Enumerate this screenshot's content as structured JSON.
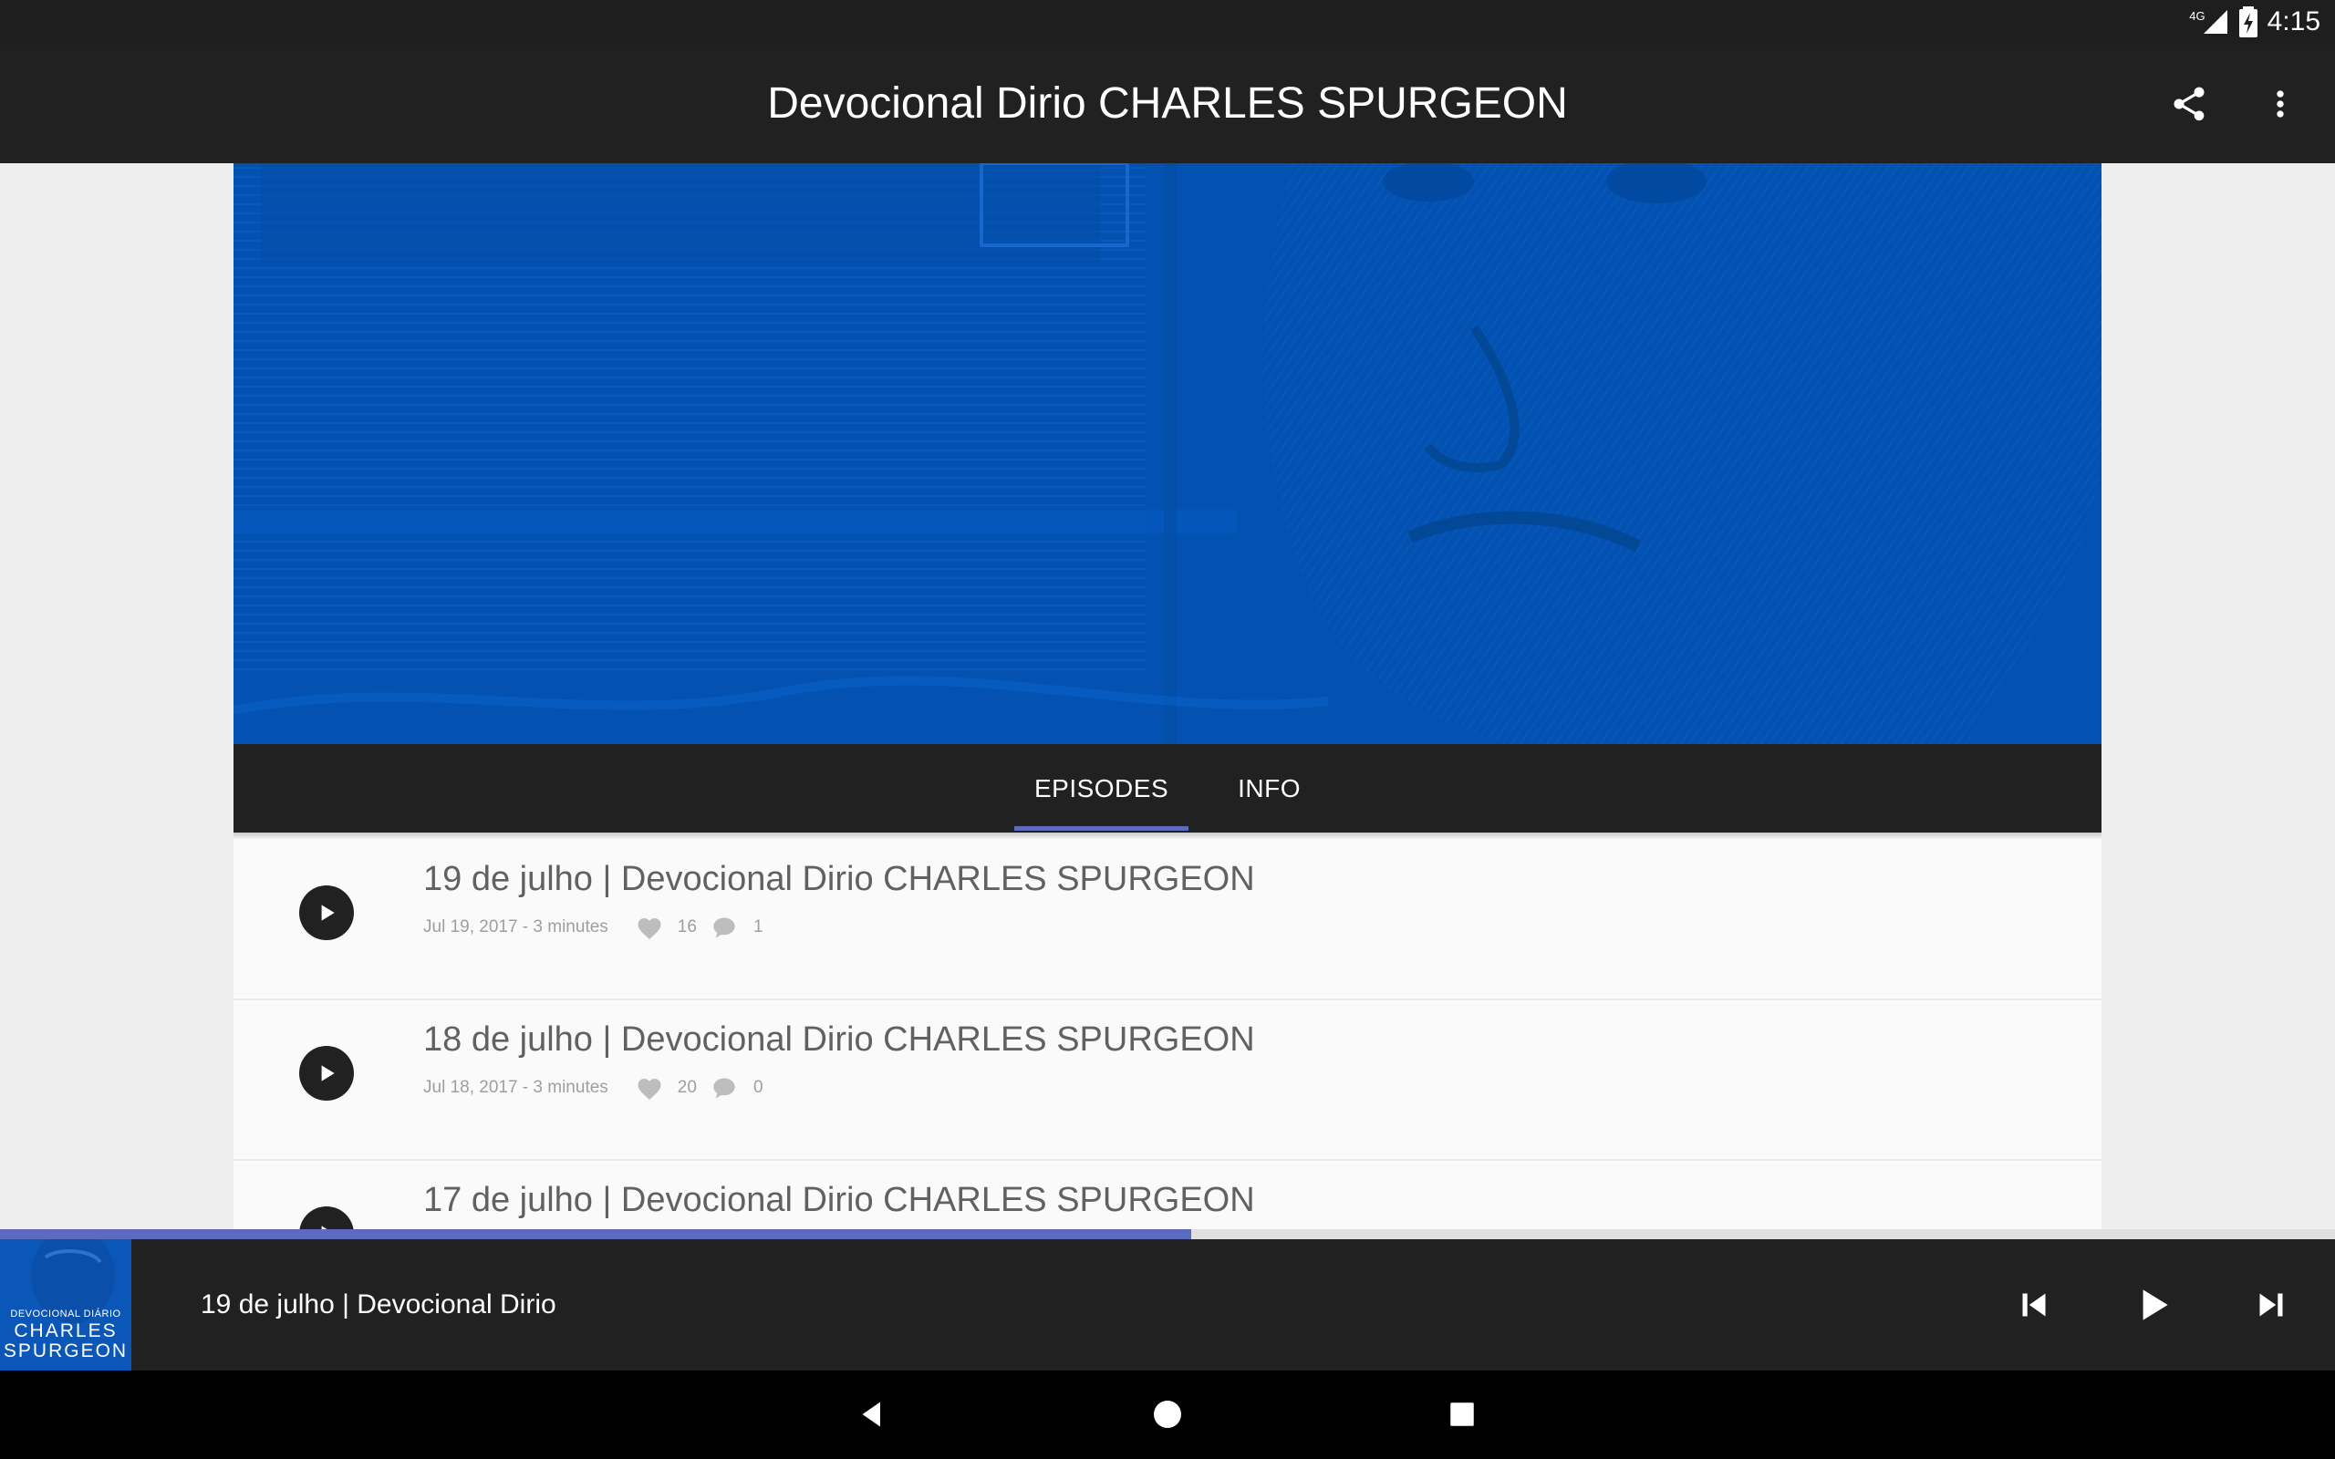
{
  "status": {
    "network": "4G",
    "time": "4:15"
  },
  "app_bar": {
    "title": "Devocional Dirio CHARLES SPURGEON",
    "actions": [
      "share-icon",
      "more-vert-icon"
    ]
  },
  "tabs": [
    {
      "label": "EPISODES",
      "active": true
    },
    {
      "label": "INFO",
      "active": false
    }
  ],
  "episodes": [
    {
      "title": "19 de julho | Devocional Dirio CHARLES SPURGEON",
      "meta": "Jul 19, 2017 - 3 minutes",
      "likes": "16",
      "comments": "1"
    },
    {
      "title": "18 de julho | Devocional Dirio CHARLES SPURGEON",
      "meta": "Jul 18, 2017 - 3 minutes",
      "likes": "20",
      "comments": "0"
    },
    {
      "title": "17 de julho | Devocional Dirio CHARLES SPURGEON"
    }
  ],
  "player": {
    "title": "19 de julho | Devocional Dirio",
    "progress_fraction": 0.51,
    "artwork": {
      "line1": "DEVOCIONAL DIÁRIO",
      "line2": "CHARLES",
      "line3": "SPURGEON"
    }
  },
  "colors": {
    "accent": "#5c6bc0",
    "hero_blue": "#0352b2",
    "bar": "#212121"
  }
}
